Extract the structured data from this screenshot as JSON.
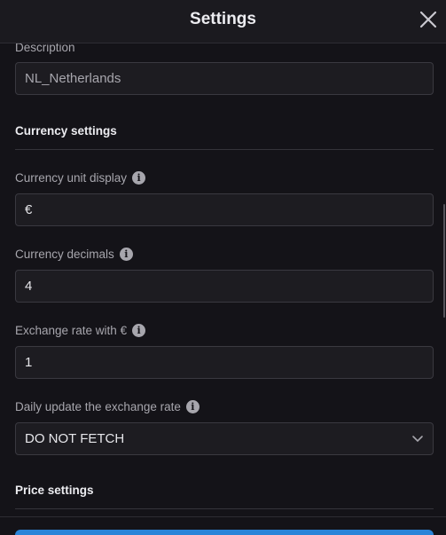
{
  "header": {
    "title": "Settings",
    "close_icon": "close-icon"
  },
  "form": {
    "description": {
      "label": "Description",
      "value": "NL_Netherlands"
    },
    "currency_section": "Currency settings",
    "currency_unit": {
      "label": "Currency unit display",
      "value": "€"
    },
    "currency_decimals": {
      "label": "Currency decimals",
      "value": "4"
    },
    "exchange_rate": {
      "label": "Exchange rate with €",
      "value": "1"
    },
    "daily_update": {
      "label": "Daily update the exchange rate",
      "value": "DO NOT FETCH"
    },
    "price_section": "Price settings"
  },
  "colors": {
    "background": "#141318",
    "field_background": "#1d1c21",
    "accent": "#2a84d8"
  }
}
